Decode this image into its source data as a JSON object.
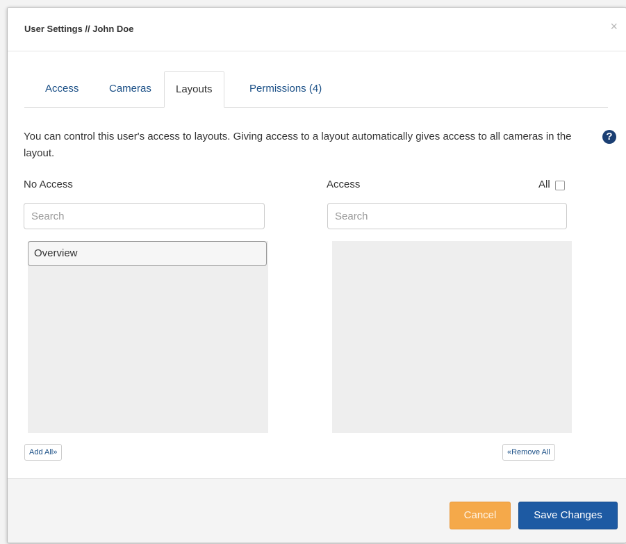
{
  "dialog": {
    "title": "User Settings // John Doe",
    "close_glyph": "×"
  },
  "tabs": [
    {
      "label": "Access",
      "active": false
    },
    {
      "label": "Cameras",
      "active": false
    },
    {
      "label": "Layouts",
      "active": true
    },
    {
      "label": "Permissions (4)",
      "active": false
    }
  ],
  "description": "You can control this user's access to layouts. Giving access to a layout automatically gives access to all cameras in the layout.",
  "help_icon": {
    "glyph": "?",
    "icon": "question-circle-icon"
  },
  "no_access": {
    "heading": "No Access",
    "search_placeholder": "Search",
    "items": [
      "Overview"
    ],
    "add_all_label": "Add All»"
  },
  "access": {
    "heading": "Access",
    "all_label": "All",
    "all_checked": false,
    "search_placeholder": "Search",
    "items": [],
    "remove_all_label": "«Remove All"
  },
  "footer": {
    "cancel_label": "Cancel",
    "save_label": "Save Changes"
  },
  "colors": {
    "link": "#1a4f86",
    "save_button": "#1d5aa3",
    "cancel_button": "#f5a94a",
    "help_icon": "#1b3f73"
  }
}
